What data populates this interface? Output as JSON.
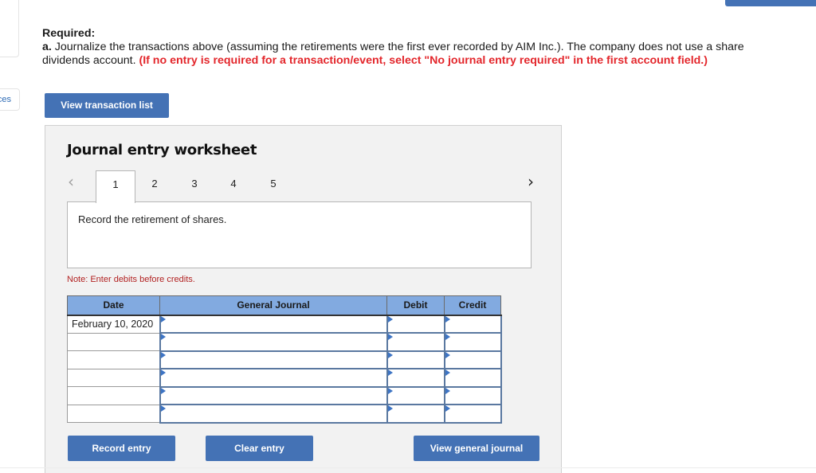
{
  "side_panel": {
    "references_label_fragment": "ces"
  },
  "required": {
    "title": "Required:",
    "part_label": "a.",
    "text": " Journalize the transactions above (assuming the retirements were the first ever recorded by AIM Inc.). The company does not use a share dividends account. ",
    "red_instruction": "(If no entry is required for a transaction/event, select \"No journal entry required\" in the first account field.)"
  },
  "buttons": {
    "view_transaction_list": "View transaction list",
    "record_entry": "Record entry",
    "clear_entry": "Clear entry",
    "view_general_journal": "View general journal"
  },
  "worksheet": {
    "title": "Journal entry worksheet",
    "prev_icon": "chevron-left-icon",
    "next_icon": "chevron-right-icon",
    "tabs": [
      "1",
      "2",
      "3",
      "4",
      "5"
    ],
    "active_tab": "1",
    "instruction": "Record the retirement of shares.",
    "note": "Note: Enter debits before credits."
  },
  "table": {
    "headers": [
      "Date",
      "General Journal",
      "Debit",
      "Credit"
    ],
    "rows": [
      {
        "date": "February 10, 2020",
        "account": "",
        "debit": "",
        "credit": ""
      },
      {
        "date": "",
        "account": "",
        "debit": "",
        "credit": ""
      },
      {
        "date": "",
        "account": "",
        "debit": "",
        "credit": ""
      },
      {
        "date": "",
        "account": "",
        "debit": "",
        "credit": ""
      },
      {
        "date": "",
        "account": "",
        "debit": "",
        "credit": ""
      },
      {
        "date": "",
        "account": "",
        "debit": "",
        "credit": ""
      }
    ]
  },
  "colors": {
    "button_blue": "#4472b5",
    "header_blue": "#82aae0",
    "red_note": "#e3262b",
    "worksheet_bg": "#f2f2f2"
  }
}
